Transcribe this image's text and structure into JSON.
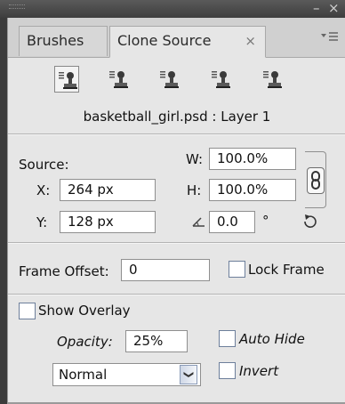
{
  "window": {
    "minimize_label": "–",
    "close_label": "×"
  },
  "tabs": [
    {
      "label": "Brushes",
      "active": false
    },
    {
      "label": "Clone Source",
      "active": true,
      "close": "×"
    }
  ],
  "panel_menu_icon": "menu-lines-icon",
  "clone_sources": {
    "count": 5,
    "selected_index": 0,
    "icon": "clone-stamp-icon"
  },
  "layer_info": "basketball_girl.psd : Layer 1",
  "source": {
    "label": "Source:",
    "x_label": "X:",
    "x_value": "264 px",
    "y_label": "Y:",
    "y_value": "128 px",
    "w_label": "W:",
    "w_value": "100.0%",
    "h_label": "H:",
    "h_value": "100.0%",
    "angle_value": "0.0",
    "degree_symbol": "°",
    "link_icon": "chain-link-icon",
    "reset_icon": "reset-transform-icon",
    "angle_icon": "angle-icon"
  },
  "frame": {
    "offset_label": "Frame Offset:",
    "offset_value": "0",
    "lock_label": "Lock Frame",
    "lock_checked": false
  },
  "overlay": {
    "show_label": "Show Overlay",
    "show_checked": false,
    "opacity_label": "Opacity:",
    "opacity_value": "25%",
    "auto_hide_label": "Auto Hide",
    "auto_hide_checked": false,
    "invert_label": "Invert",
    "invert_checked": false,
    "blend_mode": "Normal"
  },
  "colors": {
    "panel_bg": "#e6e6e6",
    "chrome": "#3b3b3b",
    "checkbox_border": "#6d7f9b"
  }
}
